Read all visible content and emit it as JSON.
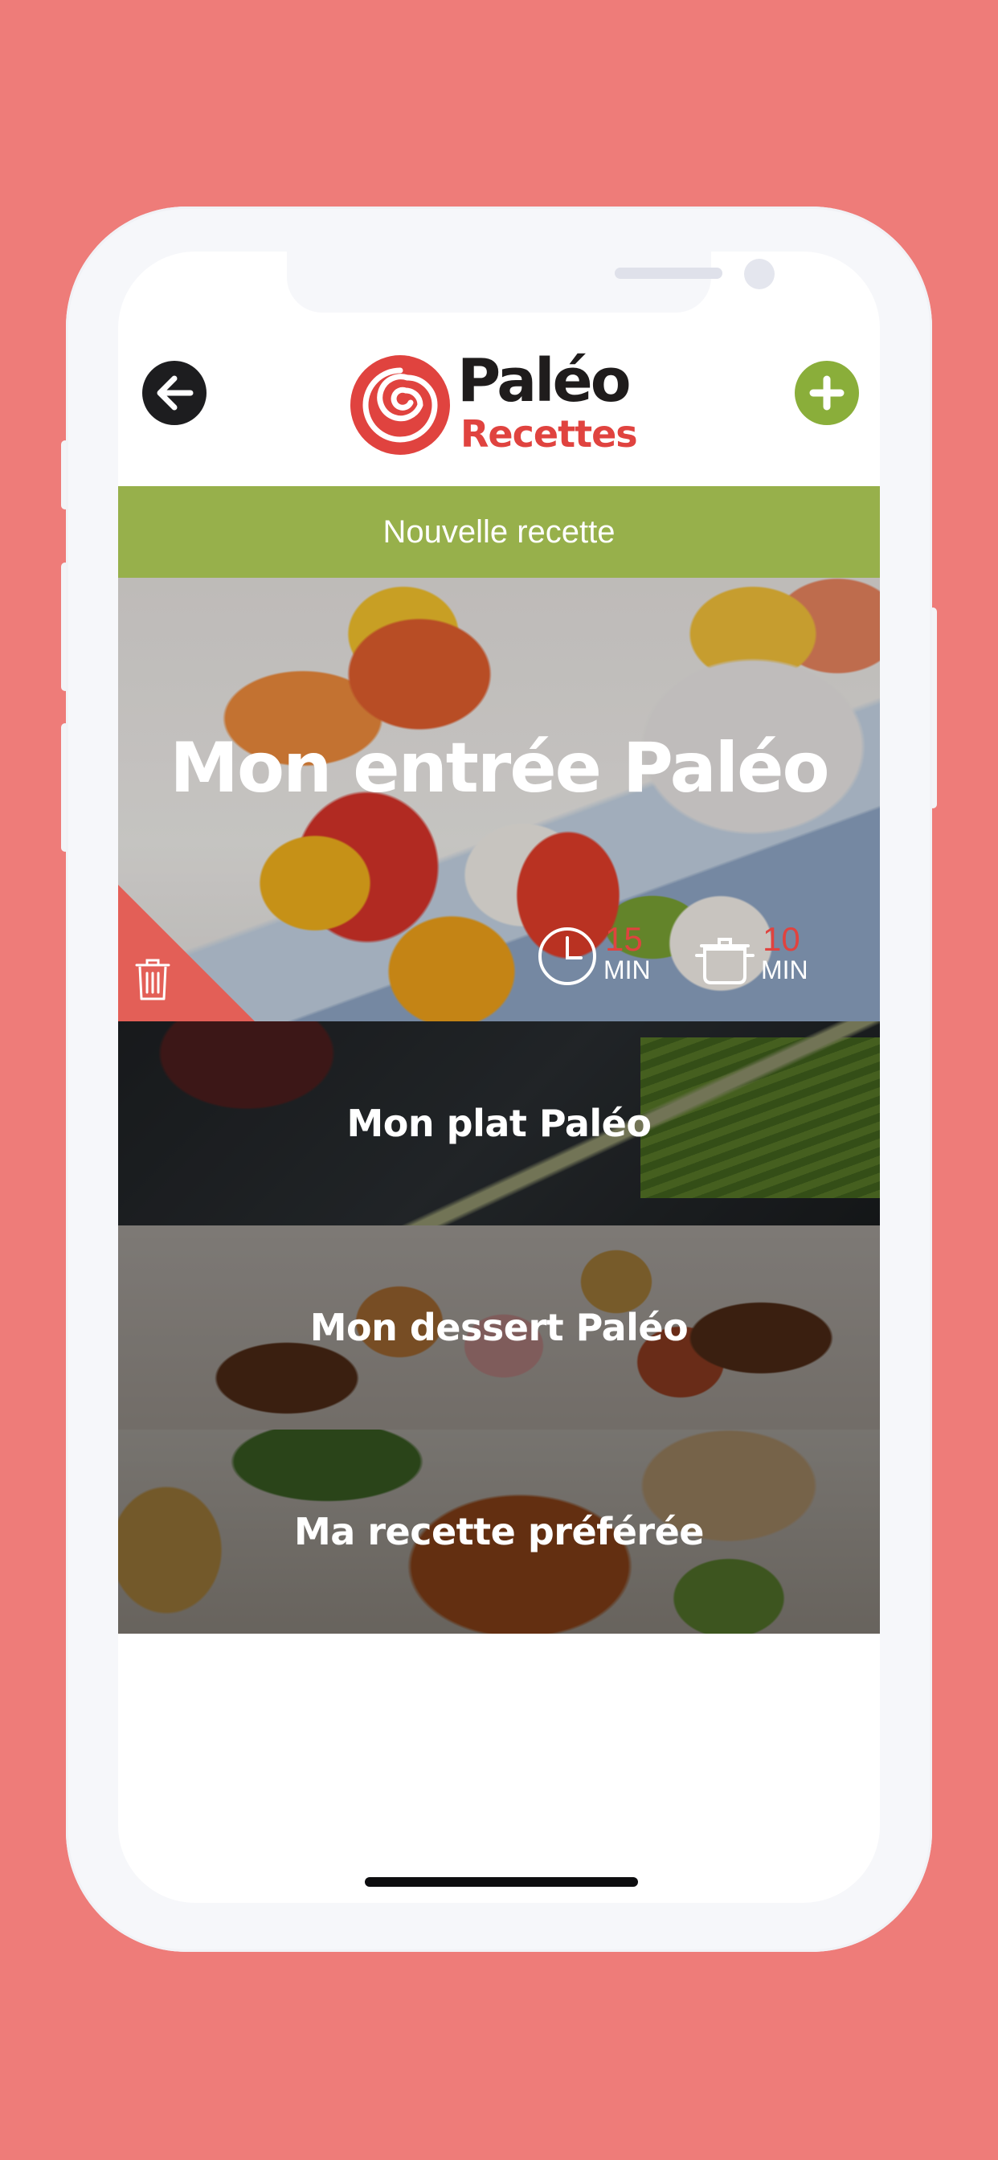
{
  "header": {
    "logo": {
      "line1": "Paléo",
      "line2": "Recettes"
    },
    "back_icon": "arrow-left-icon",
    "add_icon": "plus-icon"
  },
  "banner": {
    "title": "Nouvelle recette"
  },
  "featured": {
    "title": "Mon entrée Paléo",
    "prep_time": {
      "value": "15",
      "unit": "MIN",
      "icon": "clock-icon"
    },
    "cook_time": {
      "value": "10",
      "unit": "MIN",
      "icon": "pot-icon"
    },
    "delete_icon": "trash-icon"
  },
  "recipes": [
    {
      "label": "Mon plat Paléo"
    },
    {
      "label": "Mon dessert Paléo"
    },
    {
      "label": "Ma recette préférée"
    }
  ],
  "colors": {
    "background": "#ee7c79",
    "accent_green": "#97b04b",
    "accent_red": "#e0433f",
    "logo_dark": "#1f1c1c"
  }
}
